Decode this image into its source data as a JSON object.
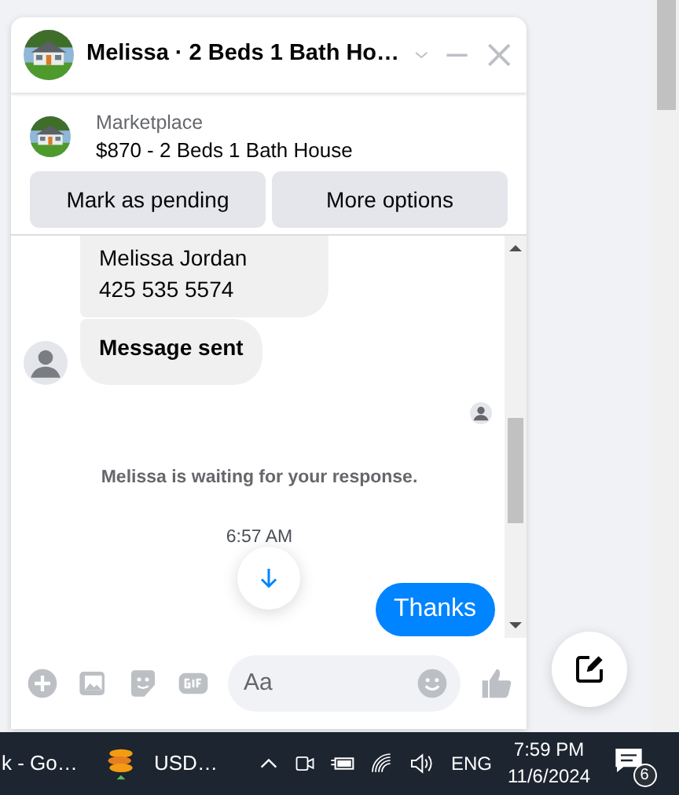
{
  "chat": {
    "title": "Melissa · 2 Beds 1 Bath Ho…",
    "listing": {
      "source": "Marketplace",
      "title": "$870 - 2 Beds 1 Bath House"
    },
    "actions": [
      "Mark as pending",
      "More options"
    ],
    "messages": [
      {
        "kind": "incoming",
        "lines": [
          "Melissa Jordan",
          "425 535 5574"
        ],
        "avatar": false
      },
      {
        "kind": "incoming",
        "lines": [
          "Message sent"
        ],
        "avatar": true
      },
      {
        "kind": "read-receipt"
      },
      {
        "kind": "notice",
        "text": "Melissa is waiting for your response."
      },
      {
        "kind": "timestamp",
        "text": "6:57 AM"
      },
      {
        "kind": "outgoing",
        "lines": [
          "Thanks"
        ]
      }
    ],
    "composer": {
      "placeholder": "Aa"
    }
  },
  "taskbar": {
    "apps": [
      {
        "label": "k - Go…"
      },
      {
        "label": "USD…"
      }
    ],
    "language": "ENG",
    "time": "7:59 PM",
    "date": "11/6/2024",
    "notifications": "6"
  }
}
